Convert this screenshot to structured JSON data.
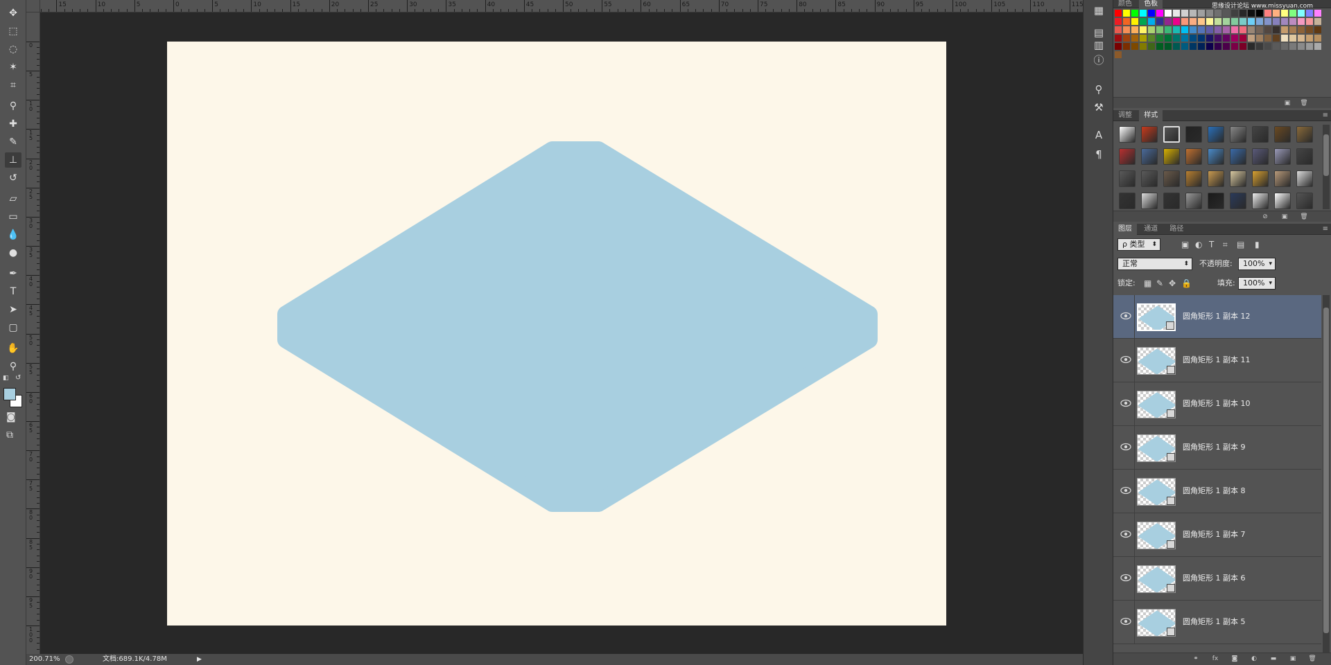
{
  "rulers": {
    "top_labels": [
      "15",
      "10",
      "5",
      "0",
      "5",
      "10",
      "15",
      "20",
      "25",
      "30",
      "35",
      "40",
      "45",
      "50",
      "55",
      "60",
      "65",
      "70",
      "75",
      "80",
      "85",
      "90",
      "95",
      "100",
      "105",
      "110",
      "115",
      "120",
      "125"
    ],
    "left_labels": [
      "0",
      "5",
      "10",
      "15",
      "20",
      "25",
      "30",
      "35",
      "40",
      "45",
      "50",
      "55",
      "60",
      "65",
      "70",
      "75",
      "80",
      "85",
      "90",
      "95",
      "100"
    ]
  },
  "colors": {
    "document_bg": "#fdf7e9",
    "shape_fill": "#a8cfe0",
    "foreground": "#a8cfe0",
    "background": "#ffffff",
    "selection": "#5a6880"
  },
  "status": {
    "zoom": "200.71%",
    "doc_size": "文档:689.1K/4.78M"
  },
  "tools": [
    "move-tool",
    "marquee-tool",
    "lasso-tool",
    "magic-wand-tool",
    "crop-tool",
    "eyedropper-tool",
    "healing-brush-tool",
    "brush-tool",
    "clone-stamp-tool",
    "history-brush-tool",
    "eraser-tool",
    "gradient-tool",
    "blur-tool",
    "dodge-tool",
    "pen-tool",
    "type-tool",
    "path-selection-tool",
    "shape-tool",
    "hand-tool",
    "zoom-tool"
  ],
  "swatches_panel": {
    "tabs": [
      "颜色",
      "色板"
    ],
    "active_tab": "色板",
    "watermark": "思缘设计论坛 www.missyuan.com"
  },
  "styles_panel": {
    "tabs": [
      "调整",
      "样式"
    ],
    "active_tab": "样式"
  },
  "layers_panel": {
    "tabs": [
      "图层",
      "通道",
      "路径"
    ],
    "active_tab": "图层",
    "filter_label": "ρ 类型",
    "blend_mode": "正常",
    "opacity_label": "不透明度:",
    "opacity_value": "100%",
    "lock_label": "锁定:",
    "fill_label": "填充:",
    "fill_value": "100%",
    "layers": [
      {
        "name": "圆角矩形 1 副本 12",
        "selected": true
      },
      {
        "name": "圆角矩形 1 副本 11",
        "selected": false
      },
      {
        "name": "圆角矩形 1 副本 10",
        "selected": false
      },
      {
        "name": "圆角矩形 1 副本 9",
        "selected": false
      },
      {
        "name": "圆角矩形 1 副本 8",
        "selected": false
      },
      {
        "name": "圆角矩形 1 副本 7",
        "selected": false
      },
      {
        "name": "圆角矩形 1 副本 6",
        "selected": false
      },
      {
        "name": "圆角矩形 1 副本 5",
        "selected": false
      }
    ],
    "footer_icons": [
      "link-icon",
      "fx-icon",
      "mask-icon",
      "adjustment-icon",
      "folder-icon",
      "new-layer-icon",
      "trash-icon"
    ]
  }
}
